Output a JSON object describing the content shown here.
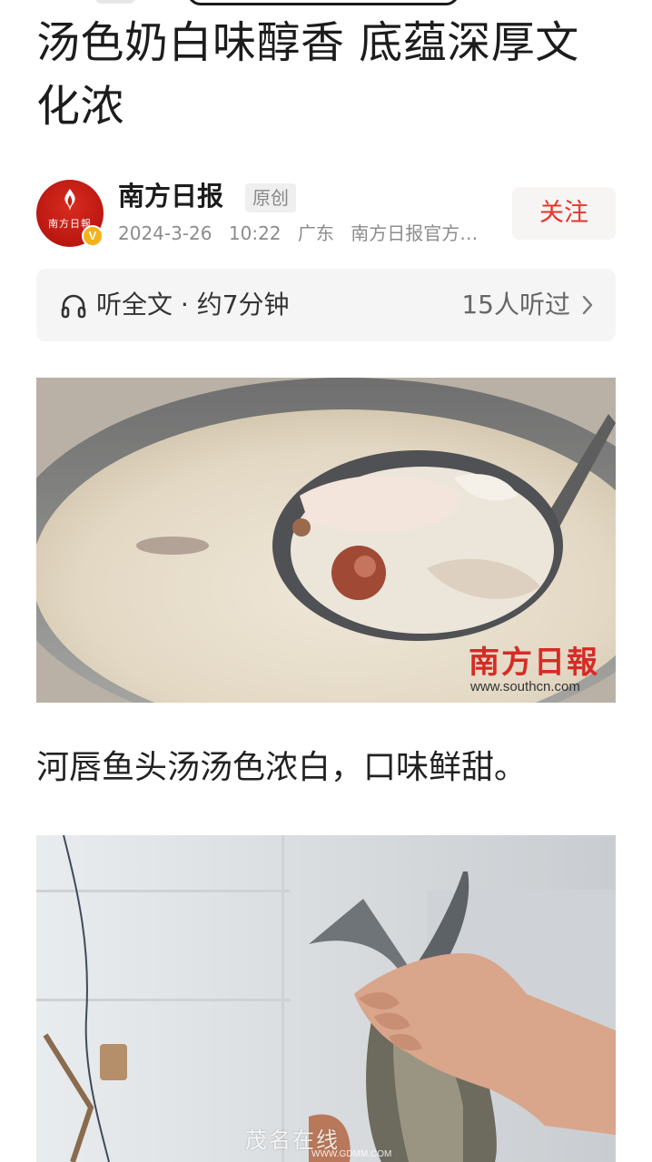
{
  "article": {
    "title": "汤色奶白味醇香 底蕴深厚文化浓",
    "caption": "河唇鱼头汤汤色浓白，口味鲜甜。"
  },
  "author": {
    "name": "南方日报",
    "tag": "原创",
    "avatar_text": "南方日報",
    "verified_badge": "V",
    "date": "2024-3-26",
    "time": "10:22",
    "region": "广东",
    "source": "南方日报官方…",
    "follow_label": "关注"
  },
  "listen": {
    "icon": "headphones-icon",
    "label": "听全文 · 约7分钟",
    "listeners": "15人听过"
  },
  "photo1": {
    "watermark_cn": "南方日報",
    "watermark_url": "www.southcn.com"
  },
  "footer_watermark": {
    "text": "茂名在线",
    "url": "WWW.GDMM.COM"
  },
  "colors": {
    "accent": "#e5352b",
    "avatar_bg": "#c41d15",
    "badge": "#f4b21b",
    "listen_bg": "#f5f5f5"
  }
}
